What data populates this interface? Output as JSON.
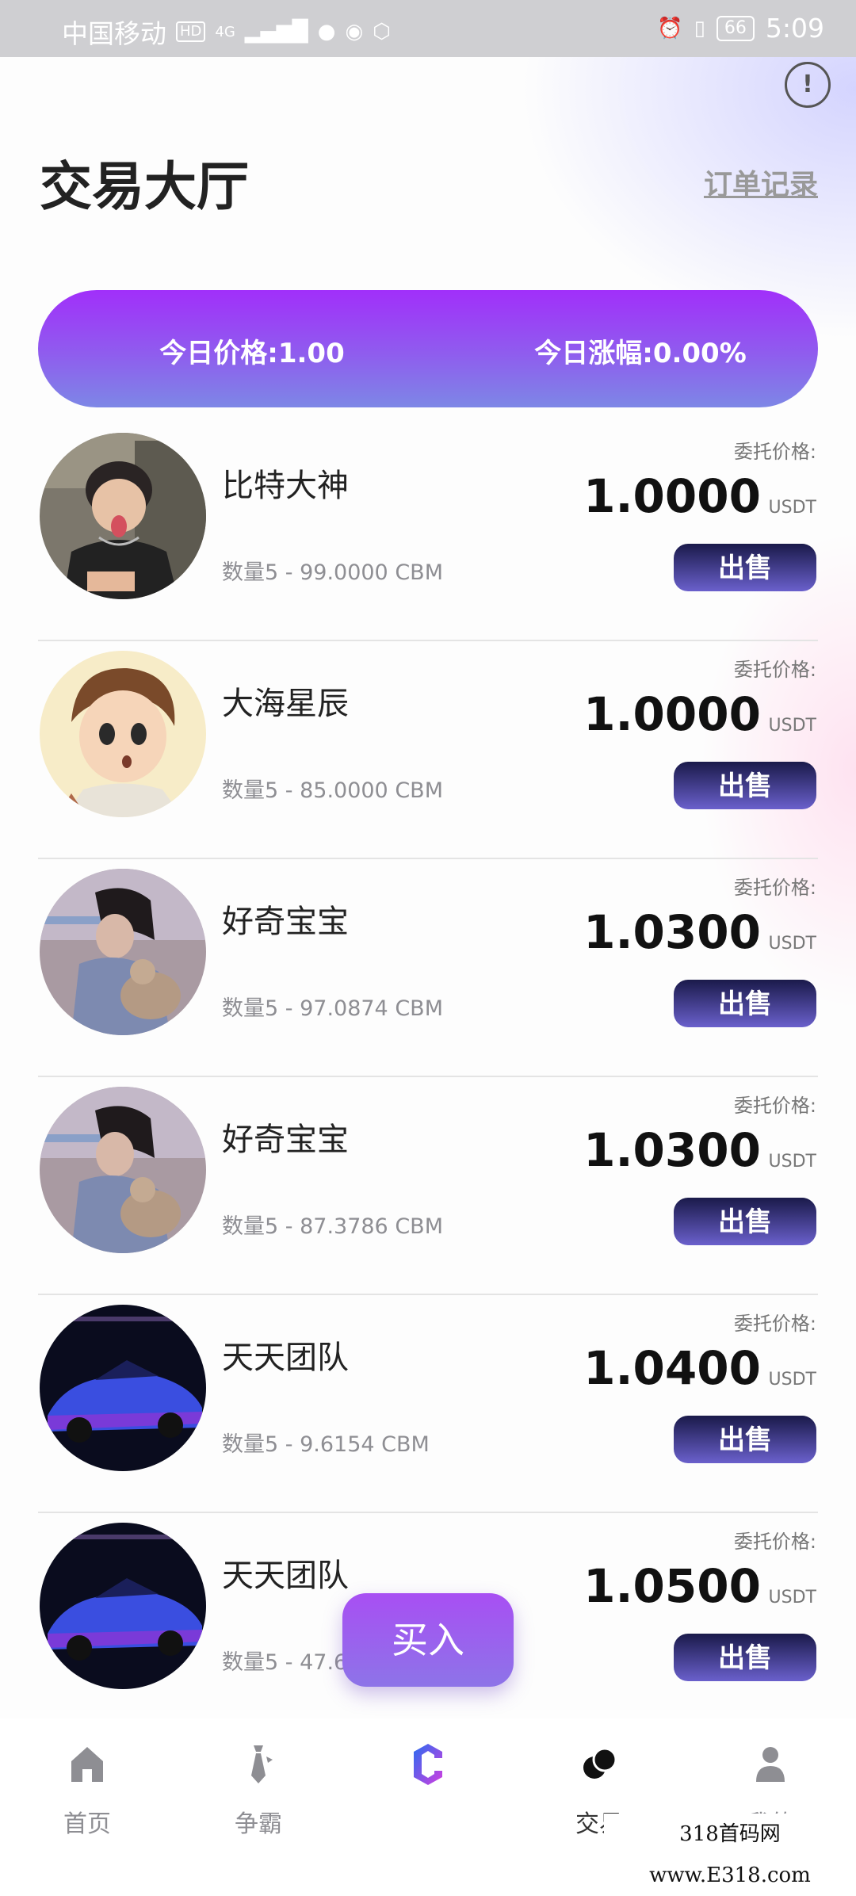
{
  "status_bar": {
    "carrier": "中国移动",
    "hd": "HD",
    "network": "4G",
    "battery": "66",
    "time": "5:09"
  },
  "header": {
    "title": "交易大厅",
    "order_link": "订单记录",
    "info_icon": "!"
  },
  "banner": {
    "today_price": "今日价格:1.00",
    "today_change": "今日涨幅:0.00%"
  },
  "orders": [
    {
      "name": "比特大神",
      "qty": "数量5 - 99.0000 CBM",
      "price_label": "委托价格:",
      "price": "1.0000",
      "unit": "USDT",
      "action": "出售",
      "avatar": "boy-photo"
    },
    {
      "name": "大海星辰",
      "qty": "数量5 - 85.0000 CBM",
      "price_label": "委托价格:",
      "price": "1.0000",
      "unit": "USDT",
      "action": "出售",
      "avatar": "cartoon-boy"
    },
    {
      "name": "好奇宝宝",
      "qty": "数量5 - 97.0874 CBM",
      "price_label": "委托价格:",
      "price": "1.0300",
      "unit": "USDT",
      "action": "出售",
      "avatar": "girl-with-cat"
    },
    {
      "name": "好奇宝宝",
      "qty": "数量5 - 87.3786 CBM",
      "price_label": "委托价格:",
      "price": "1.0300",
      "unit": "USDT",
      "action": "出售",
      "avatar": "girl-with-cat"
    },
    {
      "name": "天天团队",
      "qty": "数量5 - 9.6154 CBM",
      "price_label": "委托价格:",
      "price": "1.0400",
      "unit": "USDT",
      "action": "出售",
      "avatar": "blue-sports-car"
    },
    {
      "name": "天天团队",
      "qty": "数量5 - 47.61",
      "price_label": "委托价格:",
      "price": "1.0500",
      "unit": "USDT",
      "action": "出售",
      "avatar": "blue-sports-car"
    }
  ],
  "buy_button": "买入",
  "tabs": [
    {
      "label": "首页",
      "icon": "home-icon"
    },
    {
      "label": "争霸",
      "icon": "tie-icon"
    },
    {
      "label": "",
      "icon": "logo-c-icon"
    },
    {
      "label": "交易",
      "icon": "coins-icon"
    },
    {
      "label": "我的",
      "icon": "user-icon"
    }
  ],
  "watermark": "318首码网 www.E318.com",
  "colors": {
    "banner_start": "#a12ffa",
    "banner_end": "#7d87e6",
    "sell_button_dark": "#1a1a4a",
    "sell_button_light": "#6a60cc",
    "buy_button": "#a84ff3"
  }
}
